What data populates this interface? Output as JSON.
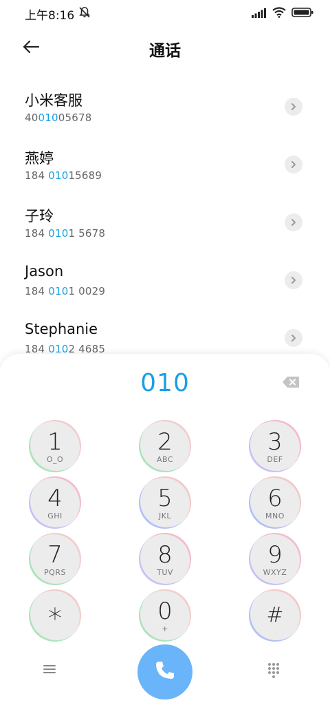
{
  "status_bar": {
    "time": "上午8:16"
  },
  "header": {
    "title": "通话"
  },
  "contacts": [
    {
      "name": "小米客服",
      "number_prefix": "40",
      "number_match": "010",
      "number_suffix": "05678"
    },
    {
      "name": "燕婷",
      "number_prefix": "184 ",
      "number_match": "010",
      "number_suffix": "15689"
    },
    {
      "name": "子玲",
      "number_prefix": "184 ",
      "number_match": "010",
      "number_suffix": "1 5678"
    },
    {
      "name": "Jason",
      "number_prefix": "184 ",
      "number_match": "010",
      "number_suffix": "1 0029"
    },
    {
      "name": "Stephanie",
      "number_prefix": "184 ",
      "number_match": "010",
      "number_suffix": "2 4685"
    }
  ],
  "dialpad": {
    "input_value": "010",
    "keys": [
      {
        "digit": "1",
        "letters": "O_O"
      },
      {
        "digit": "2",
        "letters": "ABC"
      },
      {
        "digit": "3",
        "letters": "DEF"
      },
      {
        "digit": "4",
        "letters": "GHI"
      },
      {
        "digit": "5",
        "letters": "JKL"
      },
      {
        "digit": "6",
        "letters": "MNO"
      },
      {
        "digit": "7",
        "letters": "PQRS"
      },
      {
        "digit": "8",
        "letters": "TUV"
      },
      {
        "digit": "9",
        "letters": "WXYZ"
      },
      {
        "digit": "*",
        "letters": ""
      },
      {
        "digit": "0",
        "letters": "+"
      },
      {
        "digit": "#",
        "letters": ""
      }
    ]
  },
  "colors": {
    "accent": "#1aa0e6",
    "call_button": "#6ab4fa",
    "key_bg": "#ececec"
  },
  "icons": {
    "back": "back-arrow-icon",
    "silent": "bell-off-icon",
    "signal": "signal-icon",
    "wifi": "wifi-icon",
    "battery": "battery-icon",
    "chevron": "chevron-right-icon",
    "backspace": "backspace-icon",
    "menu": "menu-icon",
    "call": "phone-icon",
    "keypad": "keypad-icon"
  }
}
